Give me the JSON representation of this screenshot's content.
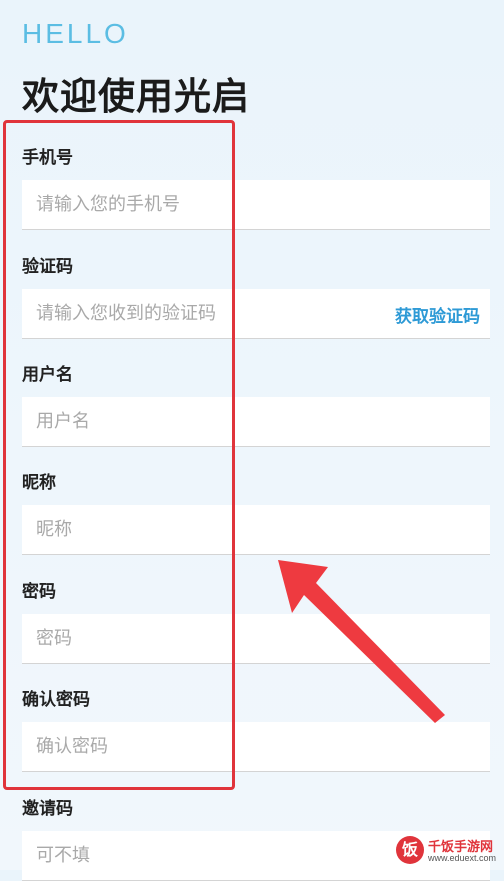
{
  "header": {
    "greeting": "HELLO",
    "title": "欢迎使用光启"
  },
  "form": {
    "phone": {
      "label": "手机号",
      "placeholder": "请输入您的手机号"
    },
    "code": {
      "label": "验证码",
      "placeholder": "请输入您收到的验证码",
      "action": "获取验证码"
    },
    "username": {
      "label": "用户名",
      "placeholder": "用户名"
    },
    "nickname": {
      "label": "昵称",
      "placeholder": "昵称"
    },
    "password": {
      "label": "密码",
      "placeholder": "密码"
    },
    "confirm": {
      "label": "确认密码",
      "placeholder": "确认密码"
    },
    "invite": {
      "label": "邀请码",
      "placeholder": "可不填"
    }
  },
  "watermark": {
    "logo_char": "饭",
    "text": "千饭手游网",
    "url": "www.eduext.com"
  },
  "colors": {
    "accent": "#2e9ad6",
    "greeting": "#5bbde3",
    "annotation": "#e0343b"
  }
}
